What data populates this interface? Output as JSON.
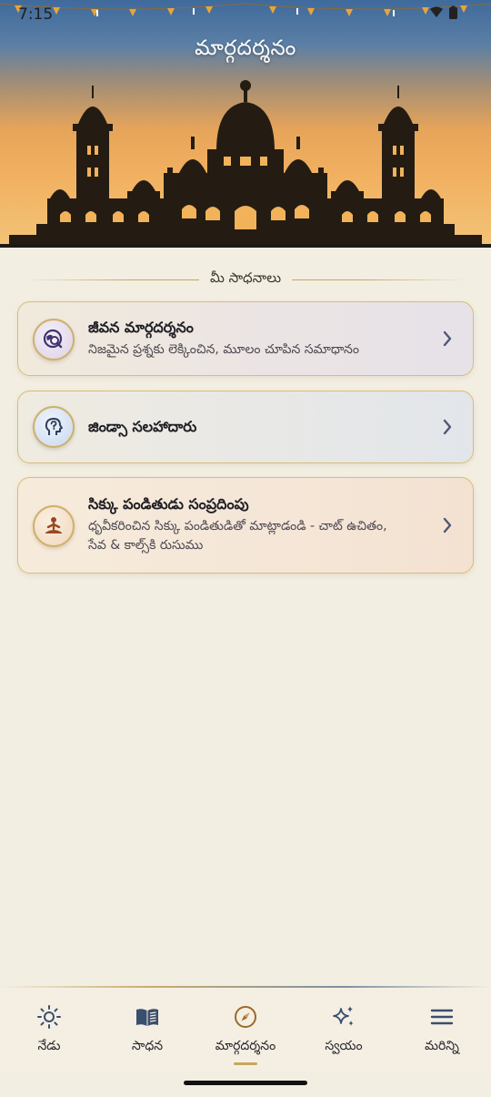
{
  "status_bar": {
    "time": "7:15"
  },
  "header": {
    "title": "మార్గదర్శనం"
  },
  "section": {
    "label": "మీ సాధనాలు"
  },
  "cards": [
    {
      "title": "జీవన మార్గదర్శనం",
      "description": "నిజమైన ప్రశ్నకు లెక్కించిన, మూలం చూపిన సమాధానం",
      "icon": "search-globe-icon"
    },
    {
      "title": "జిండ్సా సలహాదారు",
      "description": "",
      "icon": "head-question-icon"
    },
    {
      "title": "సిక్కు పండితుడు సంప్రదింపు",
      "description_line1": "ధృవీకరించిన సిక్కు పండితుడితో మాట్లాడండి - చాట్ ఉచితం,",
      "description_line2": "సేవ & కాల్స్‌కి రుసుము",
      "icon": "meditation-icon"
    }
  ],
  "bottom_nav": {
    "items": [
      {
        "label": "నేడు",
        "icon": "sun-icon"
      },
      {
        "label": "సాధన",
        "icon": "book-icon"
      },
      {
        "label": "మార్గదర్శనం",
        "icon": "compass-icon",
        "active": true
      },
      {
        "label": "స్వయం",
        "icon": "sparkles-icon"
      },
      {
        "label": "మరిన్ని",
        "icon": "menu-icon"
      }
    ]
  },
  "colors": {
    "background": "#f3eee2",
    "gold_accent": "#c7a75c",
    "text_dark": "#1e1e24",
    "icon_purple": "#4a3a7a",
    "icon_orange": "#9a4a1e"
  }
}
